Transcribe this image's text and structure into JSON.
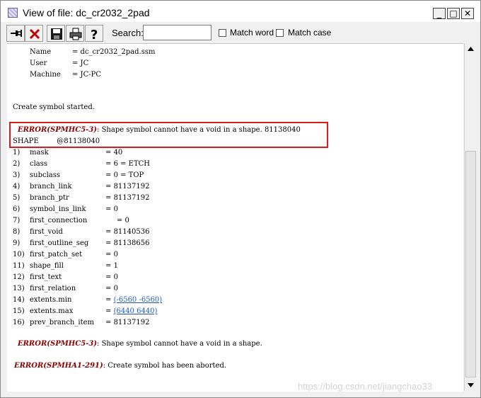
{
  "window": {
    "title": "View of file: dc_cr2032_2pad"
  },
  "title_buttons": {
    "minimize": "_",
    "maximize": "□",
    "close": "✕"
  },
  "toolbar": {
    "search_label": "Search:",
    "search_value": "",
    "match_word_label": "Match word",
    "match_case_label": "Match case",
    "icons": [
      "pin-icon",
      "delete-icon",
      "save-icon",
      "print-icon",
      "help-icon"
    ]
  },
  "header": [
    {
      "key": "Name",
      "val": "= dc_cr2032_2pad.ssm"
    },
    {
      "key": "User",
      "val": "= JC"
    },
    {
      "key": "Machine",
      "val": "= JC-PC"
    }
  ],
  "log": {
    "started": "Create symbol started.",
    "error1_code": "ERROR(SPMHC5-3)",
    "error1_msg": ": Shape symbol cannot have a void in a shape. 81138040",
    "shape_line": "SHAPE        @81138040",
    "fields": [
      {
        "num": "1)",
        "name": "mask",
        "sep": "= ",
        "value": "40",
        "link": false
      },
      {
        "num": "2)",
        "name": "class",
        "sep": "= ",
        "value": "6 = ETCH",
        "link": false
      },
      {
        "num": "3)",
        "name": "subclass",
        "sep": "= ",
        "value": "0 = TOP",
        "link": false
      },
      {
        "num": "4)",
        "name": "branch_link",
        "sep": "= ",
        "value": "81137192",
        "link": false
      },
      {
        "num": "5)",
        "name": "branch_ptr",
        "sep": "= ",
        "value": "81137192",
        "link": false
      },
      {
        "num": "6)",
        "name": "symbol_ins_link",
        "sep": "= ",
        "value": "0",
        "link": false
      },
      {
        "num": "7)",
        "name": "first_connection",
        "sep": "     = ",
        "value": "0",
        "link": false
      },
      {
        "num": "8)",
        "name": "first_void",
        "sep": "= ",
        "value": "81140536",
        "link": false
      },
      {
        "num": "9)",
        "name": "first_outline_seg",
        "sep": "= ",
        "value": "81138656",
        "link": false
      },
      {
        "num": "10)",
        "name": "first_patch_set",
        "sep": "= ",
        "value": "0",
        "link": false
      },
      {
        "num": "11)",
        "name": "shape_fill",
        "sep": "= ",
        "value": "1",
        "link": false
      },
      {
        "num": "12)",
        "name": "first_text",
        "sep": "= ",
        "value": "0",
        "link": false
      },
      {
        "num": "13)",
        "name": "first_relation",
        "sep": "= ",
        "value": "0",
        "link": false
      },
      {
        "num": "14)",
        "name": "extents.min",
        "sep": "= ",
        "value": "(-6560 -6560)",
        "link": true
      },
      {
        "num": "15)",
        "name": "extents.max",
        "sep": "= ",
        "value": "(6440 6440)",
        "link": true
      },
      {
        "num": "16)",
        "name": "prev_branch_item",
        "sep": "= ",
        "value": "81137192",
        "link": false
      }
    ],
    "error2_code": "ERROR(SPMHC5-3)",
    "error2_msg": ": Shape symbol cannot have a void in a shape.",
    "error3_code": "ERROR(SPMHA1-291)",
    "error3_msg": ": Create symbol has been aborted."
  },
  "watermark": "https://blog.csdn.net/jiangchao33",
  "colors": {
    "error": "#8b0000",
    "link": "#1c59c7",
    "highlight_box": "#e11b1b"
  }
}
